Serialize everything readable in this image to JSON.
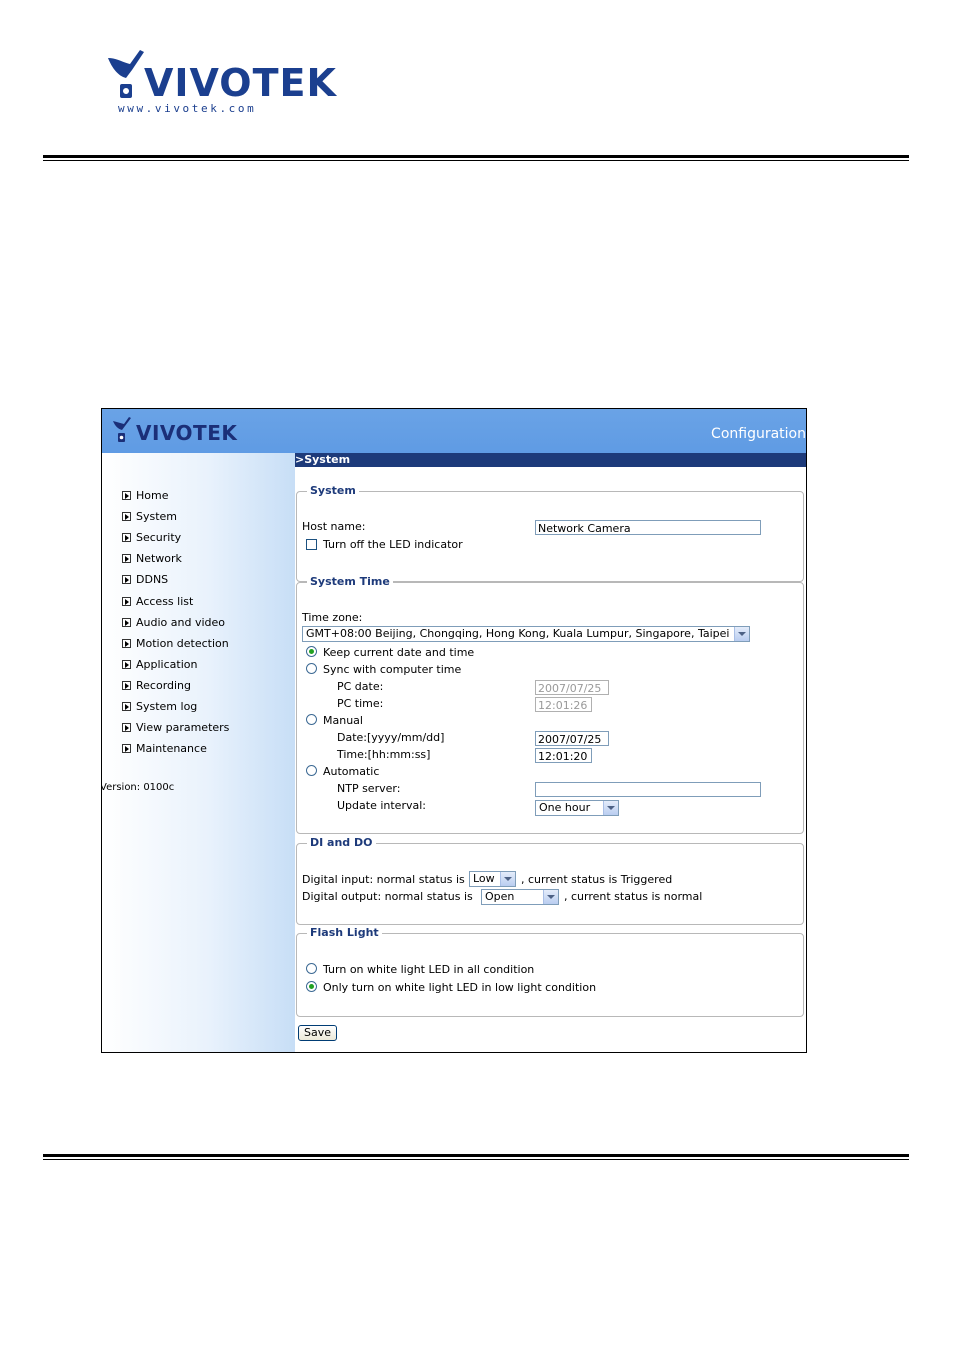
{
  "document": {
    "brand": "VIVOTEK",
    "url": "www.vivotek.com"
  },
  "app": {
    "brand": "VIVOTEK",
    "title": "Configuration",
    "section": "System",
    "version": "Version: 0100c"
  },
  "sidebar": {
    "items": [
      {
        "label": "Home"
      },
      {
        "label": "System"
      },
      {
        "label": "Security"
      },
      {
        "label": "Network"
      },
      {
        "label": "DDNS"
      },
      {
        "label": "Access list"
      },
      {
        "label": "Audio and video"
      },
      {
        "label": "Motion detection"
      },
      {
        "label": "Application"
      },
      {
        "label": "Recording"
      },
      {
        "label": "System log"
      },
      {
        "label": "View parameters"
      },
      {
        "label": "Maintenance"
      }
    ]
  },
  "system": {
    "legend": "System",
    "host_label": "Host name:",
    "host_value": "Network Camera",
    "led_label": "Turn off the LED indicator",
    "led_checked": false
  },
  "system_time": {
    "legend": "System Time",
    "tz_label": "Time zone:",
    "tz_value": "GMT+08:00 Beijing, Chongqing, Hong Kong, Kuala Lumpur, Singapore, Taipei",
    "keep_label": "Keep current date and time",
    "sync_label": "Sync with computer time",
    "pc_date_label": "PC date:",
    "pc_date_value": "2007/07/25",
    "pc_time_label": "PC time:",
    "pc_time_value": "12:01:26",
    "manual_label": "Manual",
    "date_label": "Date:[yyyy/mm/dd]",
    "date_value": "2007/07/25",
    "time_label": "Time:[hh:mm:ss]",
    "time_value": "12:01:20",
    "auto_label": "Automatic",
    "ntp_label": "NTP server:",
    "ntp_value": "",
    "interval_label": "Update interval:",
    "interval_value": "One hour",
    "selected": "keep"
  },
  "dido": {
    "legend": "DI and DO",
    "di_prefix": "Digital input: normal status is",
    "di_value": "Low",
    "di_suffix": ", current status is Triggered",
    "do_prefix": "Digital output: normal status is",
    "do_value": "Open",
    "do_suffix": ", current status is normal"
  },
  "flash": {
    "legend": "Flash Light",
    "opt1": "Turn on white light LED in all condition",
    "opt2": "Only turn on white light LED in low light condition",
    "selected": "opt2"
  },
  "save_label": "Save",
  "colors": {
    "topbar": "#5f9be4",
    "section_bar": "#1d3a7a",
    "legend": "#1d3a7a",
    "brand": "#1b3f8f"
  }
}
